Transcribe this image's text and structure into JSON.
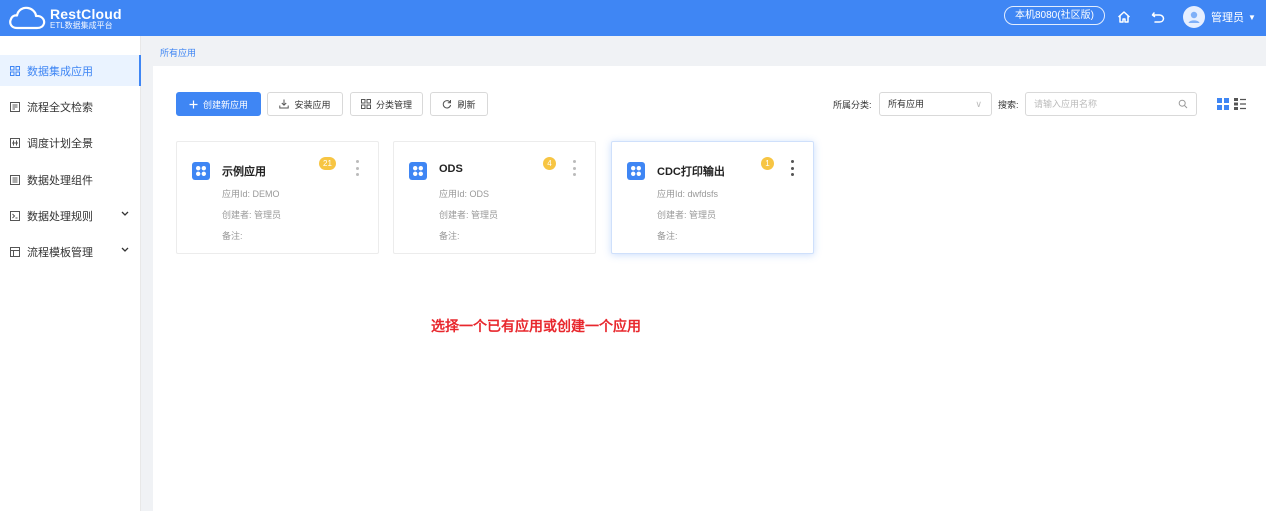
{
  "header": {
    "logo_title": "RestCloud",
    "logo_subtitle": "ETL数据集成平台",
    "server": "本机8080(社区版)",
    "user_name": "管理员",
    "icons": [
      "home-icon",
      "back-icon",
      "avatar-icon",
      "caret-down-icon"
    ],
    "color": "#3f86f4"
  },
  "sidebar": {
    "items": [
      {
        "label": "数据集成应用",
        "icon": "grid-icon",
        "active": true
      },
      {
        "label": "流程全文检索",
        "icon": "search-doc-icon"
      },
      {
        "label": "调度计划全景",
        "icon": "schedule-icon"
      },
      {
        "label": "数据处理组件",
        "icon": "component-icon"
      },
      {
        "label": "数据处理规则",
        "icon": "rule-icon",
        "expandable": true
      },
      {
        "label": "流程模板管理",
        "icon": "template-icon",
        "expandable": true
      }
    ]
  },
  "breadcrumb": "所有应用",
  "toolbar": {
    "create_label": "创建新应用",
    "install_label": "安装应用",
    "category_label": "分类管理",
    "refresh_label": "刷新",
    "category_filter_label": "所属分类:",
    "category_value": "所有应用",
    "search_label": "搜索:",
    "search_placeholder": "请输入应用名称"
  },
  "apps": [
    {
      "name": "示例应用",
      "app_id": "应用Id: DEMO",
      "creator": "创建者: 管理员",
      "note": "备注:",
      "count": "21"
    },
    {
      "name": "ODS",
      "app_id": "应用Id: ODS",
      "creator": "创建者: 管理员",
      "note": "备注:",
      "count": "4"
    },
    {
      "name": "CDC打印输出",
      "app_id": "应用Id: dwfdsfs",
      "creator": "创建者: 管理员",
      "note": "备注:",
      "count": "1"
    }
  ],
  "hint": "选择一个已有应用或创建一个应用",
  "colors": {
    "primary": "#3f86f4",
    "badge": "#f7c543",
    "hint": "#e8272d"
  }
}
